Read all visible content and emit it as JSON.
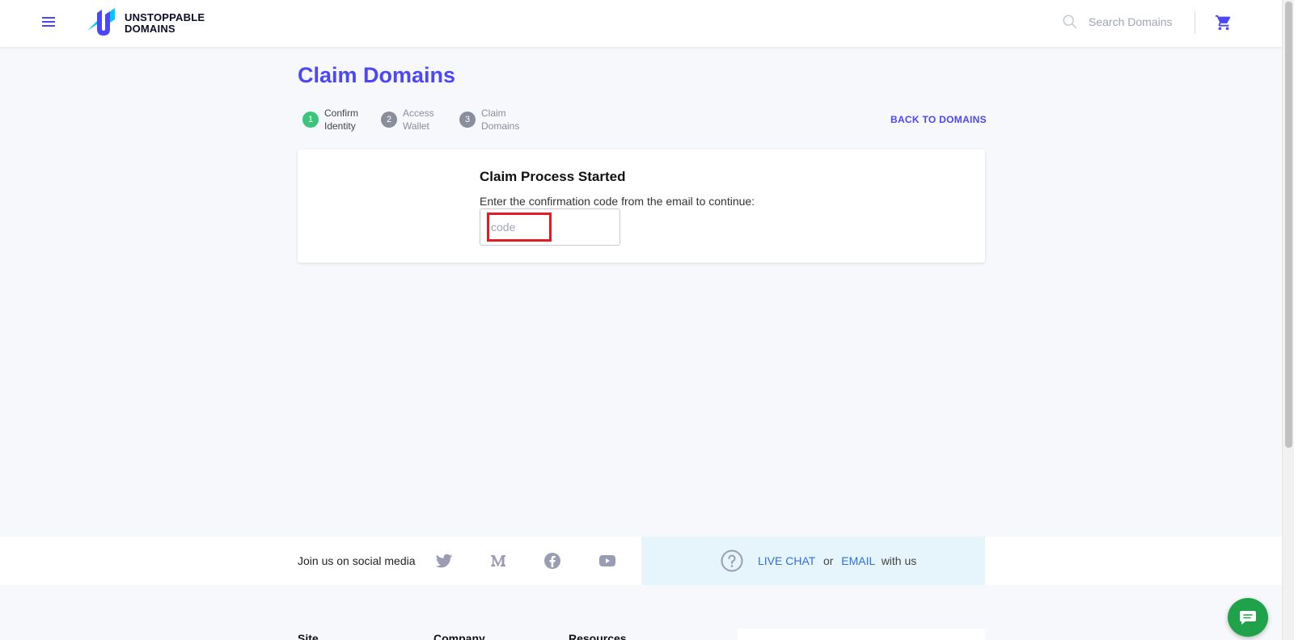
{
  "header": {
    "logo_line1": "UNSTOPPABLE",
    "logo_line2": "DOMAINS",
    "search_placeholder": "Search Domains"
  },
  "main": {
    "title": "Claim Domains",
    "back_label": "BACK TO DOMAINS",
    "steps": [
      {
        "num": "1",
        "line1": "Confirm",
        "line2": "Identity",
        "active": true
      },
      {
        "num": "2",
        "line1": "Access",
        "line2": "Wallet",
        "active": false
      },
      {
        "num": "3",
        "line1": "Claim",
        "line2": "Domains",
        "active": false
      }
    ],
    "card": {
      "heading": "Claim Process Started",
      "instruction": "Enter the confirmation code from the email to continue:",
      "code_placeholder": "code"
    }
  },
  "footer": {
    "social_label": "Join us on social media",
    "social_icons": [
      "twitter-icon",
      "medium-icon",
      "facebook-icon",
      "youtube-icon"
    ],
    "help": {
      "live_chat": "LIVE CHAT",
      "or": "or",
      "email": "EMAIL",
      "suffix": "with us"
    },
    "columns": [
      "Site",
      "Company",
      "Resources"
    ]
  },
  "colors": {
    "accent": "#4c47f7",
    "step_active": "#3cc47c",
    "chat_button": "#1fa24a",
    "highlight_border": "#e31c23"
  }
}
